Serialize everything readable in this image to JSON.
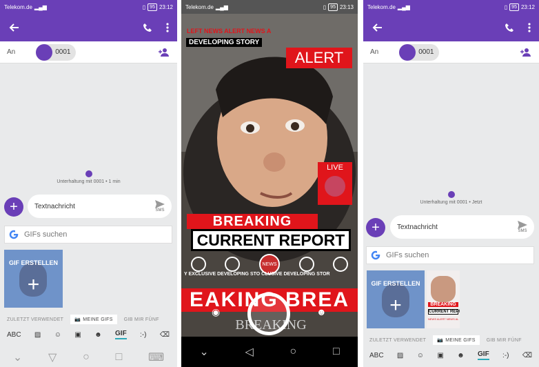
{
  "left": {
    "status": {
      "carrier": "Telekom.de",
      "battery": "95",
      "time": "23:12"
    },
    "to_label": "An",
    "contact": "0001",
    "conversation": "Unterhaltung mit 0001 • 1 min",
    "message_placeholder": "Textnachricht",
    "send_label": "SMS",
    "gif_search_placeholder": "GIFs suchen",
    "gif_create_label": "GIF ERSTELLEN",
    "tabs": [
      "ZULETZT VERWENDET",
      "MEINE GIFS",
      "GIB MIR FÜNF"
    ],
    "keyboard": [
      "ABC",
      "GIF",
      ":-)"
    ]
  },
  "middle": {
    "status": {
      "carrier": "Telekom.de",
      "battery": "95",
      "time": "23:13"
    },
    "ticker_top": "LEFT NEWS ALERT NEWS A",
    "developing": "DEVELOPING STORY",
    "alert": "ALERT",
    "live": "LIVE",
    "breaking": "BREAKING",
    "current_report": "CURRENT REPORT",
    "lower_ticker": "Y EXCLUSIVE DEVELOPING STO    CLUSIVE DEVELOPING STOR",
    "news_badge": "NEWS",
    "bottom_banner": "EAKING  BREA",
    "bottom_text": "BREAKING"
  },
  "right": {
    "status": {
      "carrier": "Telekom.de",
      "battery": "95",
      "time": "23:12"
    },
    "to_label": "An",
    "contact": "0001",
    "conversation": "Unterhaltung mit 0001 • Jetzt",
    "message_placeholder": "Textnachricht",
    "send_label": "SMS",
    "gif_search_placeholder": "GIFs suchen",
    "gif_create_label": "GIF ERSTELLEN",
    "mini_breaking": "BREAKING",
    "mini_report": "CURRENT REPORT",
    "mini_ticker": "NEWS ALERT NEWS AL",
    "tabs": [
      "ZULETZT VERWENDET",
      "MEINE GIFS",
      "GIB MIR FÜNF"
    ],
    "keyboard": [
      "ABC",
      "GIF",
      ":-)"
    ]
  },
  "colors": {
    "accent": "#6a3fb7",
    "alert_red": "#e0151b",
    "teal": "#2ba8b8"
  }
}
